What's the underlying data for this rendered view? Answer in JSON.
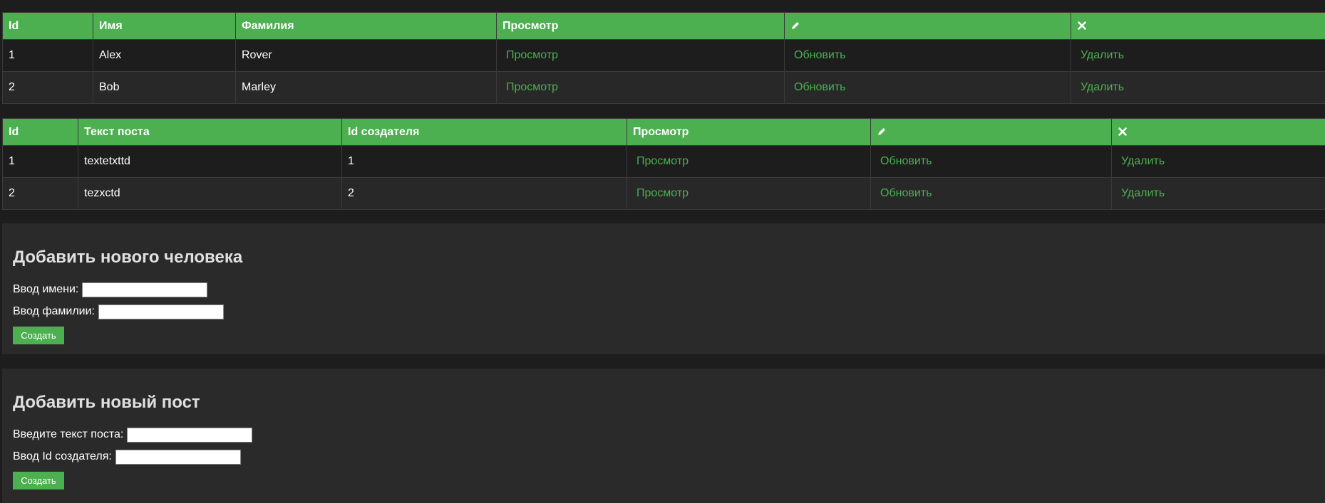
{
  "users_table": {
    "headers": {
      "id": "Id",
      "first_name": "Имя",
      "last_name": "Фамилия",
      "view": "Просмотр",
      "edit_icon": "pencil-icon",
      "delete_icon": "close-icon"
    },
    "rows": [
      {
        "id": "1",
        "first_name": "Alex",
        "last_name": "Rover",
        "view": "Просмотр",
        "update": "Обновить",
        "delete": "Удалить"
      },
      {
        "id": "2",
        "first_name": "Bob",
        "last_name": "Marley",
        "view": "Просмотр",
        "update": "Обновить",
        "delete": "Удалить"
      }
    ]
  },
  "posts_table": {
    "headers": {
      "id": "Id",
      "text": "Текст поста",
      "creator_id": "Id создателя",
      "view": "Просмотр",
      "edit_icon": "pencil-icon",
      "delete_icon": "close-icon"
    },
    "rows": [
      {
        "id": "1",
        "text": "textetxttd",
        "creator_id": "1",
        "view": "Просмотр",
        "update": "Обновить",
        "delete": "Удалить"
      },
      {
        "id": "2",
        "text": "tezxctd",
        "creator_id": "2",
        "view": "Просмотр",
        "update": "Обновить",
        "delete": "Удалить"
      }
    ]
  },
  "person_form": {
    "title": "Добавить нового человека",
    "first_name_label": "Ввод имени:",
    "first_name_value": "",
    "last_name_label": "Ввод фамилии:",
    "last_name_value": "",
    "submit_label": "Создать"
  },
  "post_form": {
    "title": "Добавить новый пост",
    "text_label": "Введите текст поста:",
    "text_value": "",
    "creator_label": "Ввод Id создателя:",
    "creator_value": "",
    "submit_label": "Создать"
  },
  "colors": {
    "accent": "#4caf50",
    "background": "#1d1d1d",
    "panel": "#2a2a2a"
  }
}
